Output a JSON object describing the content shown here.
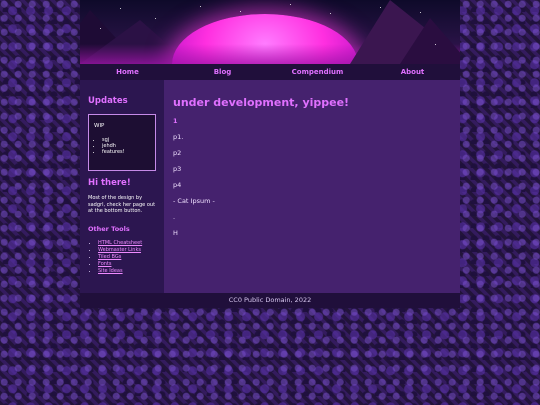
{
  "nav": {
    "items": [
      {
        "label": "Home"
      },
      {
        "label": "Blog"
      },
      {
        "label": "Compendium"
      },
      {
        "label": "About"
      }
    ]
  },
  "sidebar": {
    "updates_title": "Updates",
    "wip_label": "WIP",
    "wip_items": [
      "sgj",
      "jehdh",
      "features!"
    ],
    "hello_title": "Hi there!",
    "hello_text": "Most of the design by sadgrl, check her page out at the bottom button.",
    "tools_title": "Other Tools",
    "tools": [
      "HTML Cheatsheet",
      "Webmaster Links",
      "Tiled BGs",
      "Fonts",
      "Site Ideas"
    ]
  },
  "main": {
    "heading": "under development, yippee!",
    "lines": [
      "1",
      "p1.",
      "p2",
      "p3",
      "p4",
      "- Cat Ipsum -",
      ".",
      "H"
    ]
  },
  "footer": {
    "text": "CC0 Public Domain, 2022"
  }
}
